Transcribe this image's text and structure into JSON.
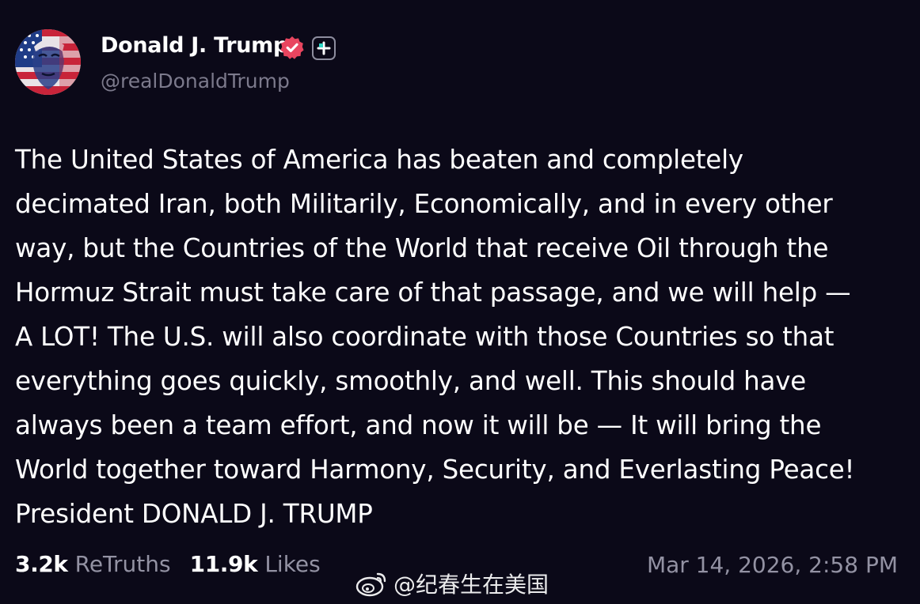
{
  "post": {
    "author": {
      "display_name": "Donald J. Trump",
      "handle": "@realDonaldTrump",
      "verified_color": "#e8455f"
    },
    "body_lines": [
      "The United States of America has beaten and completely",
      "decimated Iran, both Militarily, Economically, and in every other",
      "way, but the Countries of the World that receive Oil through the",
      "Hormuz Strait must take care of that passage, and we will help —",
      "A LOT! The U.S. will also coordinate with those Countries so that",
      "everything goes quickly, smoothly, and well. This should have",
      "always been a team effort, and now it will be — It will bring the",
      "World together toward Harmony, Security, and Everlasting Peace!",
      "President DONALD J. TRUMP"
    ],
    "stats": {
      "retruths_count": "3.2k",
      "retruths_label": "ReTruths",
      "likes_count": "11.9k",
      "likes_label": "Likes"
    },
    "timestamp": "Mar 14, 2026, 2:58 PM"
  },
  "watermark": {
    "text": "@纪春生在美国",
    "icon": "weibo-logo-icon"
  },
  "colors": {
    "background": "#0b0918",
    "text_primary": "#ffffff",
    "text_secondary": "#9392a3",
    "verified_badge": "#e8455f"
  }
}
